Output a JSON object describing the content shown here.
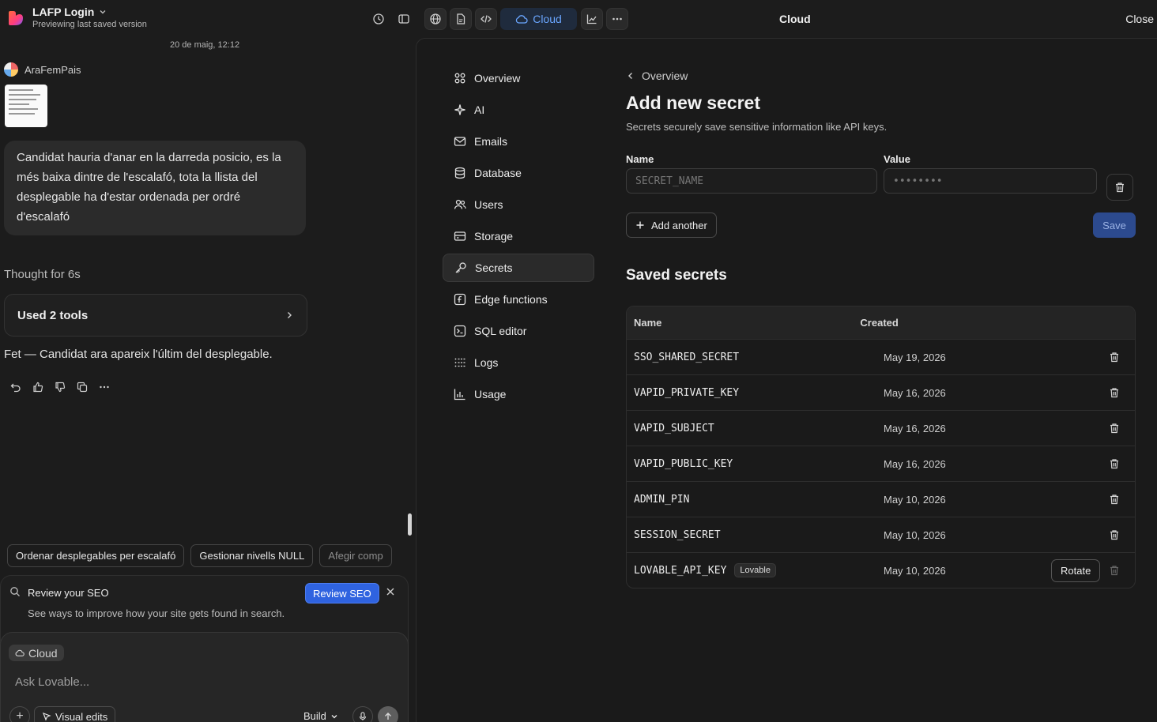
{
  "header": {
    "project_name": "LAFP Login",
    "project_subtitle": "Previewing last saved version",
    "cloud_label": "Cloud",
    "panel_title": "Cloud",
    "close_label": "Close"
  },
  "chat": {
    "timestamp": "20 de maig, 12:12",
    "user_name": "AraFemPais",
    "user_message": "Candidat hauria d'anar en la darreda posicio, es la més baixa dintre de l'escalafó, tota la llista del desplegable ha d'estar ordenada per ordré d'escalafó",
    "thought": "Thought for 6s",
    "tools_label": "Used 2 tools",
    "answer": "Fet — Candidat ara apareix l'últim del desplegable.",
    "suggestions": [
      "Ordenar desplegables per escalafó",
      "Gestionar nivells NULL",
      "Afegir comp"
    ]
  },
  "seo": {
    "title": "Review your SEO",
    "description": "See ways to improve how your site gets found in search.",
    "button": "Review SEO"
  },
  "composer": {
    "tag": "Cloud",
    "placeholder": "Ask Lovable...",
    "visual_edits": "Visual edits",
    "mode": "Build"
  },
  "nav": {
    "items": [
      {
        "label": "Overview",
        "icon": "grid-icon"
      },
      {
        "label": "AI",
        "icon": "sparkle-icon"
      },
      {
        "label": "Emails",
        "icon": "mail-icon"
      },
      {
        "label": "Database",
        "icon": "database-icon"
      },
      {
        "label": "Users",
        "icon": "users-icon"
      },
      {
        "label": "Storage",
        "icon": "storage-icon"
      },
      {
        "label": "Secrets",
        "icon": "key-icon",
        "active": true
      },
      {
        "label": "Edge functions",
        "icon": "function-icon"
      },
      {
        "label": "SQL editor",
        "icon": "terminal-icon"
      },
      {
        "label": "Logs",
        "icon": "list-icon"
      },
      {
        "label": "Usage",
        "icon": "chart-icon"
      }
    ]
  },
  "secret_form": {
    "breadcrumb": "Overview",
    "title": "Add new secret",
    "description": "Secrets securely save sensitive information like API keys.",
    "name_label": "Name",
    "name_placeholder": "SECRET_NAME",
    "value_label": "Value",
    "value_placeholder": "••••••••",
    "add_another": "Add another",
    "save": "Save"
  },
  "saved_secrets": {
    "title": "Saved secrets",
    "columns": [
      "Name",
      "Created"
    ],
    "rows": [
      {
        "name": "SSO_SHARED_SECRET",
        "created": "May 19, 2026"
      },
      {
        "name": "VAPID_PRIVATE_KEY",
        "created": "May 16, 2026"
      },
      {
        "name": "VAPID_SUBJECT",
        "created": "May 16, 2026"
      },
      {
        "name": "VAPID_PUBLIC_KEY",
        "created": "May 16, 2026"
      },
      {
        "name": "ADMIN_PIN",
        "created": "May 10, 2026"
      },
      {
        "name": "SESSION_SECRET",
        "created": "May 10, 2026"
      },
      {
        "name": "LOVABLE_API_KEY",
        "created": "May 10, 2026",
        "badge": "Lovable",
        "action": "Rotate"
      }
    ]
  },
  "colors": {
    "accent": "#2f63e0",
    "cloud_pill": "#6aa6ff",
    "background": "#1c1c1c"
  }
}
